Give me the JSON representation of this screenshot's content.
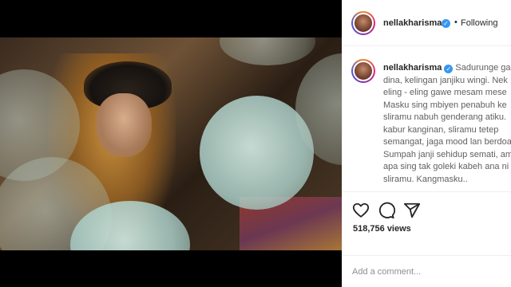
{
  "post": {
    "username": "nellakharisma",
    "verified_mark": "✓",
    "follow_separator": "•",
    "follow_label": "Following"
  },
  "caption": {
    "lines": [
      "Sadurunge gar",
      "dina, kelingan janjiku wingi. Nek",
      "eling - eling gawe mesam mese",
      "Masku sing mbiyen penabuh ke",
      "sliramu nabuh genderang atiku.",
      "kabur kanginan, sliramu tetep",
      "semangat, jaga mood lan berdoa",
      "Sumpah janji sehidup semati, am",
      "apa sing tak goleki kabeh ana ni",
      "sliramu. Kangmasku.."
    ]
  },
  "actions": {
    "like_icon": "heart-icon",
    "comment_icon": "comment-bubble-icon",
    "share_icon": "paper-plane-icon"
  },
  "stats": {
    "views": "518,756 views"
  },
  "comment": {
    "placeholder": "Add a comment..."
  },
  "colors": {
    "verified": "#3897f0",
    "text": "#262626",
    "muted": "#8e8e8e",
    "border": "#efefef",
    "media_bg": "#000000"
  }
}
